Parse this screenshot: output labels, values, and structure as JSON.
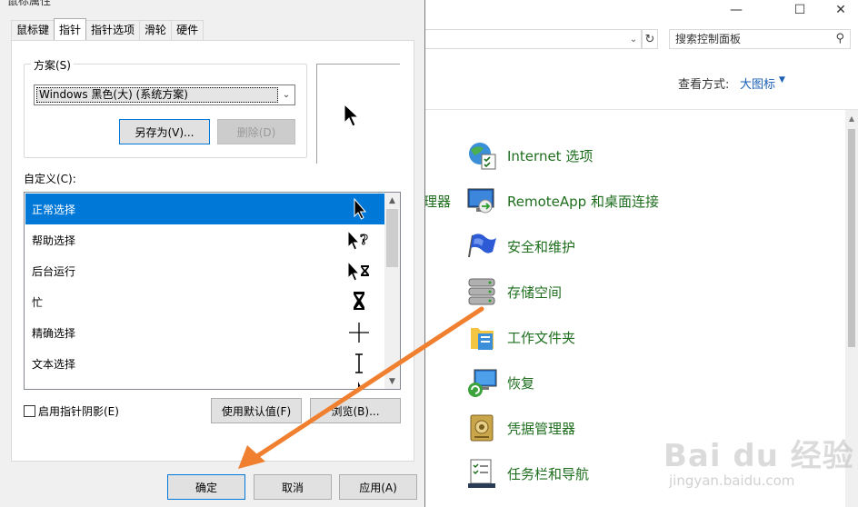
{
  "dialog": {
    "title": "鼠标属性",
    "tabs": [
      "鼠标键",
      "指针",
      "指针选项",
      "滑轮",
      "硬件"
    ],
    "active_tab": "指针",
    "scheme": {
      "label": "方案(S)",
      "selected": "Windows 黑色(大) (系统方案)",
      "save_as": "另存为(V)...",
      "delete": "删除(D)"
    },
    "custom_label": "自定义(C):",
    "cursor_list": [
      {
        "label": "正常选择",
        "cursor": "arrow",
        "selected": true
      },
      {
        "label": "帮助选择",
        "cursor": "help",
        "selected": false
      },
      {
        "label": "后台运行",
        "cursor": "working",
        "selected": false
      },
      {
        "label": "忙",
        "cursor": "busy",
        "selected": false
      },
      {
        "label": "精确选择",
        "cursor": "crosshair",
        "selected": false
      },
      {
        "label": "文本选择",
        "cursor": "ibeam",
        "selected": false
      }
    ],
    "shadow_checkbox": "启用指针阴影(E)",
    "shadow_checked": false,
    "use_default": "使用默认值(F)",
    "browse": "浏览(B)...",
    "ok": "确定",
    "cancel": "取消",
    "apply": "应用(A)"
  },
  "control_panel": {
    "search_placeholder": "搜索控制面板",
    "view_by_label": "查看方式:",
    "view_by_value": "大图标",
    "partial_item": "理器",
    "items": [
      {
        "label": "Internet 选项",
        "icon": "internet-options-icon"
      },
      {
        "label": "RemoteApp 和桌面连接",
        "icon": "remoteapp-icon"
      },
      {
        "label": "安全和维护",
        "icon": "security-flag-icon"
      },
      {
        "label": "存储空间",
        "icon": "storage-spaces-icon"
      },
      {
        "label": "工作文件夹",
        "icon": "work-folders-icon"
      },
      {
        "label": "恢复",
        "icon": "recovery-icon"
      },
      {
        "label": "凭据管理器",
        "icon": "credential-manager-icon"
      },
      {
        "label": "任务栏和导航",
        "icon": "taskbar-icon"
      }
    ]
  },
  "watermark": {
    "text": "Bai du 经验",
    "url": "jingyan.baidu.com"
  },
  "colors": {
    "accent": "#0078d7",
    "link_green": "#1e6e1e",
    "annotation_arrow": "#f08030"
  }
}
